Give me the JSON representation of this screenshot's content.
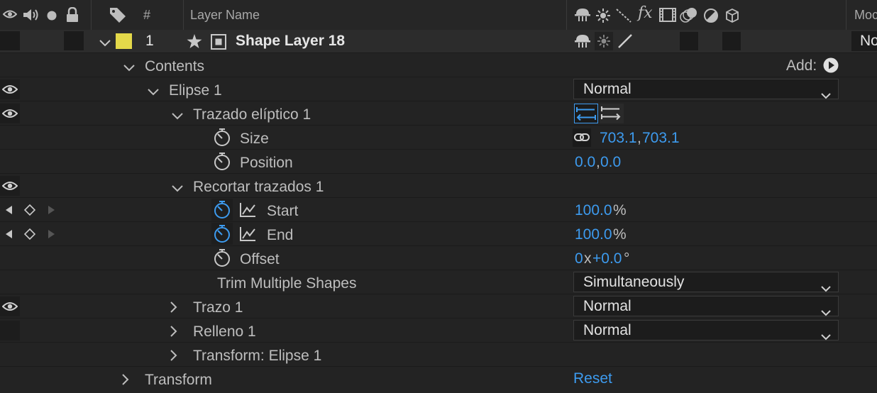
{
  "header": {
    "hash": "#",
    "layer_name": "Layer Name",
    "mode_truncated": "Moc"
  },
  "layer": {
    "number": "1",
    "name": "Shape Layer 18",
    "label_color": "#e4d94a",
    "mode_truncated": "No"
  },
  "contents": {
    "label": "Contents",
    "add_label": "Add:"
  },
  "ellipse_group": {
    "label": "Elipse 1",
    "blend_mode": "Normal"
  },
  "ellipse_path": {
    "label": "Trazado elíptico 1"
  },
  "size": {
    "label": "Size",
    "value_x": "703.1",
    "separator": ",",
    "value_y": "703.1"
  },
  "position": {
    "label": "Position",
    "value_x": "0.0",
    "separator": ",",
    "value_y": "0.0"
  },
  "trim": {
    "label": "Recortar trazados 1"
  },
  "start": {
    "label": "Start",
    "value": "100.0",
    "unit": "%"
  },
  "end": {
    "label": "End",
    "value": "100.0",
    "unit": "%"
  },
  "offset": {
    "label": "Offset",
    "revs": "0",
    "x_sep": "x",
    "degrees": "+0.0",
    "unit": "°"
  },
  "trim_multiple": {
    "label": "Trim Multiple Shapes",
    "value": "Simultaneously"
  },
  "stroke": {
    "label": "Trazo 1",
    "blend_mode": "Normal"
  },
  "fill": {
    "label": "Relleno 1",
    "blend_mode": "Normal"
  },
  "transform_ellipse": {
    "label": "Transform: Elipse 1"
  },
  "transform": {
    "label": "Transform",
    "reset_label": "Reset"
  },
  "colors": {
    "accent_blue": "#3d9bef",
    "panel_bg": "#232323",
    "layer_row_bg": "#2c2c2c"
  }
}
